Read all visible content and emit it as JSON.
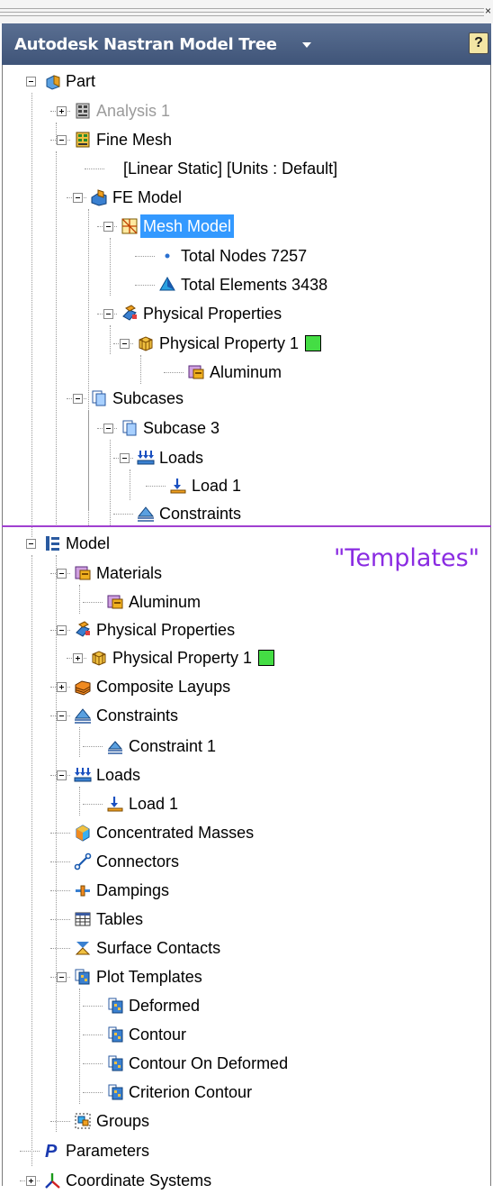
{
  "panel": {
    "title": "Autodesk Nastran Model Tree",
    "help_label": "?",
    "close_glyph": "×",
    "templates_note": "\"Templates\""
  },
  "colors": {
    "title_bar": "#4d6386",
    "selection": "#3399ff",
    "separator": "#a040d0",
    "note_text": "#8a2be2",
    "swatch_green": "#44dd44"
  },
  "tree": [
    {
      "label": "Part",
      "icon": "part-icon",
      "toggle": "minus"
    },
    {
      "label": "Analysis 1",
      "icon": "analysis-icon",
      "toggle": "plus",
      "dim": true
    },
    {
      "label": "Fine Mesh",
      "icon": "analysis-active-icon",
      "toggle": "minus"
    },
    {
      "label": "[Linear Static] [Units : Default]",
      "icon": "",
      "toggle": ""
    },
    {
      "label": "FE Model",
      "icon": "fe-model-icon",
      "toggle": "minus"
    },
    {
      "label": "Mesh Model",
      "icon": "mesh-model-icon",
      "toggle": "minus",
      "selected": true
    },
    {
      "label": "Total Nodes 7257",
      "icon": "node-icon",
      "toggle": ""
    },
    {
      "label": "Total Elements 3438",
      "icon": "element-icon",
      "toggle": ""
    },
    {
      "label": "Physical Properties",
      "icon": "physical-properties-icon",
      "toggle": "minus"
    },
    {
      "label": "Physical Property 1",
      "icon": "physical-property-icon",
      "toggle": "minus",
      "swatch": true
    },
    {
      "label": "Aluminum",
      "icon": "material-icon",
      "toggle": ""
    },
    {
      "label": "Subcases",
      "icon": "subcases-icon",
      "toggle": "minus"
    },
    {
      "label": "Subcase 3",
      "icon": "subcases-icon",
      "toggle": "minus"
    },
    {
      "label": "Loads",
      "icon": "loads-icon",
      "toggle": "minus"
    },
    {
      "label": "Load 1",
      "icon": "load-icon",
      "toggle": ""
    },
    {
      "label": "Constraints",
      "icon": "constraints-icon",
      "toggle": ""
    },
    {
      "label": "Model",
      "icon": "model-icon",
      "toggle": "minus"
    },
    {
      "label": "Materials",
      "icon": "material-icon",
      "toggle": "minus"
    },
    {
      "label": "Aluminum",
      "icon": "material-icon",
      "toggle": ""
    },
    {
      "label": "Physical Properties",
      "icon": "physical-properties-icon",
      "toggle": "minus"
    },
    {
      "label": "Physical Property 1",
      "icon": "physical-property-icon",
      "toggle": "plus",
      "swatch": true
    },
    {
      "label": "Composite Layups",
      "icon": "composite-layups-icon",
      "toggle": "plus"
    },
    {
      "label": "Constraints",
      "icon": "constraints-icon",
      "toggle": "minus"
    },
    {
      "label": "Constraint 1",
      "icon": "constraint-icon",
      "toggle": ""
    },
    {
      "label": "Loads",
      "icon": "loads-icon",
      "toggle": "minus"
    },
    {
      "label": "Load 1",
      "icon": "load-icon",
      "toggle": ""
    },
    {
      "label": "Concentrated Masses",
      "icon": "concentrated-masses-icon",
      "toggle": ""
    },
    {
      "label": "Connectors",
      "icon": "connectors-icon",
      "toggle": ""
    },
    {
      "label": "Dampings",
      "icon": "dampings-icon",
      "toggle": ""
    },
    {
      "label": "Tables",
      "icon": "tables-icon",
      "toggle": ""
    },
    {
      "label": "Surface Contacts",
      "icon": "surface-contacts-icon",
      "toggle": ""
    },
    {
      "label": "Plot Templates",
      "icon": "plot-templates-icon",
      "toggle": "minus"
    },
    {
      "label": "Deformed",
      "icon": "plot-template-icon",
      "toggle": ""
    },
    {
      "label": "Contour",
      "icon": "plot-template-icon",
      "toggle": ""
    },
    {
      "label": "Contour On Deformed",
      "icon": "plot-template-icon",
      "toggle": ""
    },
    {
      "label": "Criterion Contour",
      "icon": "plot-template-icon",
      "toggle": ""
    },
    {
      "label": "Groups",
      "icon": "groups-icon",
      "toggle": ""
    },
    {
      "label": "Parameters",
      "icon": "parameters-icon",
      "toggle": ""
    },
    {
      "label": "Coordinate Systems",
      "icon": "coordinate-systems-icon",
      "toggle": "plus"
    }
  ]
}
